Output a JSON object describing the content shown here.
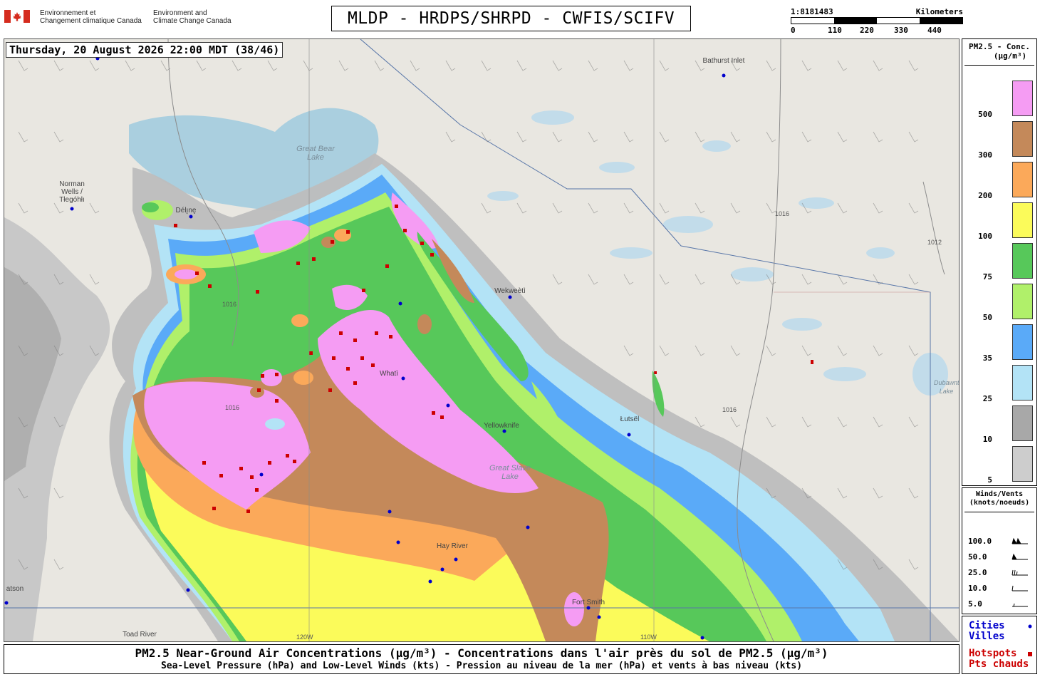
{
  "header": {
    "org_fr_line1": "Environnement et",
    "org_fr_line2": "Changement climatique Canada",
    "org_en_line1": "Environment and",
    "org_en_line2": "Climate Change Canada",
    "title": "MLDP - HRDPS/SHRPD - CWFIS/SCIFV"
  },
  "scale": {
    "ratio": "1:8181483",
    "unit": "Kilometers",
    "ticks": [
      "0",
      "110",
      "220",
      "330",
      "440"
    ]
  },
  "timestamp": "Thursday, 20 August 2026 22:00 MDT (38/46)",
  "legend": {
    "title_line1": "PM2.5 - Conc.",
    "title_line2": "(µg/m³)",
    "classes": [
      {
        "value": "500",
        "color": "#f59cf3"
      },
      {
        "value": "300",
        "color": "#c4895a"
      },
      {
        "value": "200",
        "color": "#fba95a"
      },
      {
        "value": "100",
        "color": "#fbfb5a"
      },
      {
        "value": "75",
        "color": "#57c85a"
      },
      {
        "value": "50",
        "color": "#b0f06a"
      },
      {
        "value": "35",
        "color": "#5aaaf8"
      },
      {
        "value": "25",
        "color": "#b3e3f6"
      },
      {
        "value": "10",
        "color": "#a8a8a8"
      },
      {
        "value": "5",
        "color": "#cdcdcd"
      }
    ]
  },
  "winds": {
    "title_line1": "Winds/Vents",
    "title_line2": "(knots/noeuds)",
    "values": [
      "100.0",
      "50.0",
      "25.0",
      "10.0",
      "5.0"
    ]
  },
  "cities_legend": {
    "cities_en": "Cities",
    "cities_fr": "Villes",
    "city_color": "#0000cc",
    "hotspots_en": "Hotspots",
    "hotspots_fr": "Pts chauds",
    "hotspot_color": "#cc0000"
  },
  "footer": {
    "line1": "PM2.5 Near-Ground Air Concentrations (µg/m³) - Concentrations dans l'air près du sol de PM2.5 (µg/m³)",
    "line2": "Sea-Level Pressure (hPa) and Low-Level Winds (kts) - Pression au niveau de la mer (hPa) et vents à bas niveau (kts)"
  },
  "map": {
    "places": [
      "Norman Wells / Tłegóhłı",
      "Délı̨nę",
      "Bathurst Inlet",
      "Wekweètì",
      "Whatì",
      "Yellowknife",
      "Łutsël",
      "Hay River",
      "Fort Smith",
      "Toad River",
      "atson"
    ],
    "lakes": [
      "Great Bear Lake",
      "Great Slave Lake",
      "Dubawnt Lake"
    ],
    "isobars": [
      "1016",
      "1012"
    ],
    "meridians": [
      "120W",
      "110W"
    ]
  }
}
